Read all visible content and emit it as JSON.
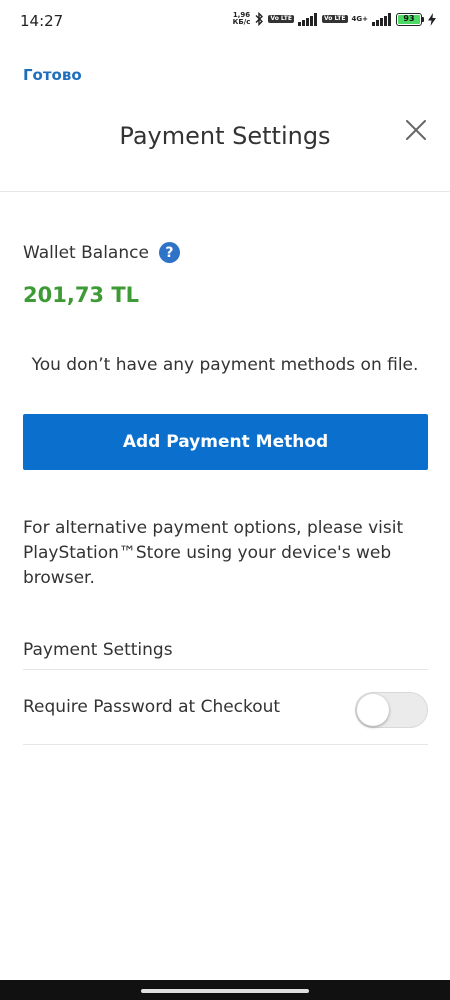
{
  "status_bar": {
    "time": "14:27",
    "net_speed_value": "1,96",
    "net_speed_unit": "КБ/с",
    "volte_label_1": "Vo LTE",
    "volte_label_2": "Vo LTE",
    "network_type": "4G+",
    "battery_percent": "93",
    "icons": [
      "bluetooth-icon",
      "signal-icon",
      "signal-icon",
      "charging-icon"
    ]
  },
  "top_bar": {
    "done_label": "Готово"
  },
  "header": {
    "title": "Payment Settings",
    "close_icon": "close-icon"
  },
  "wallet": {
    "label": "Wallet Balance",
    "help_icon_glyph": "?",
    "balance": "201,73 TL",
    "balance_color": "#3d9a35"
  },
  "payment_methods": {
    "empty_message": "You don’t have any payment methods on file.",
    "add_button_label": "Add Payment Method",
    "button_color": "#0a6fcd",
    "alternative_note": "For alternative payment options, please visit PlayStation™Store using your device's web browser."
  },
  "settings": {
    "section_title": "Payment Settings",
    "require_password_label": "Require Password at Checkout",
    "require_password_enabled": false
  },
  "colors": {
    "accent": "#1f6fbd",
    "text": "#333333"
  }
}
